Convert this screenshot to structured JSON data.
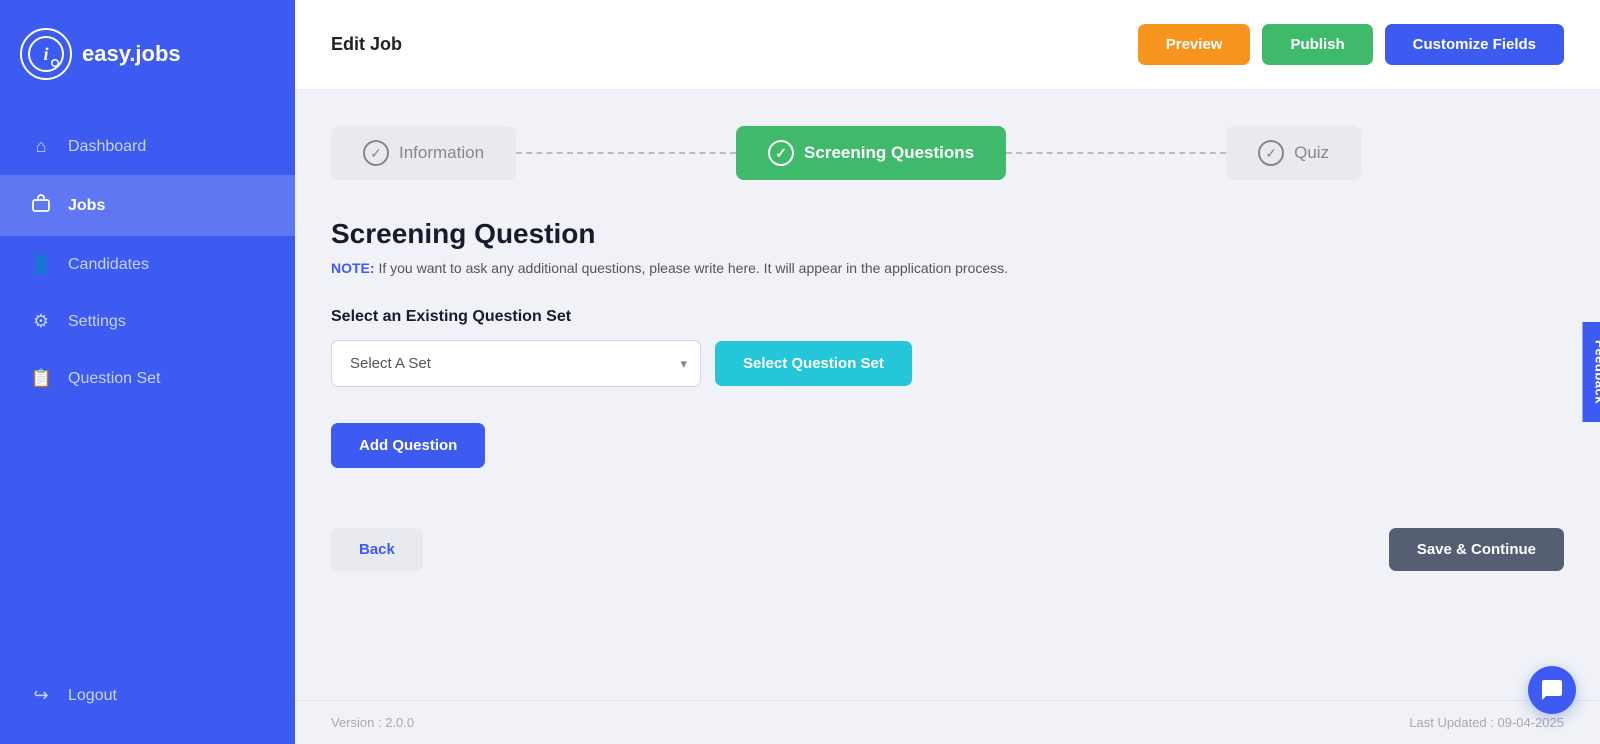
{
  "sidebar": {
    "logo_text": "easy.jobs",
    "items": [
      {
        "id": "dashboard",
        "label": "Dashboard",
        "icon": "⌂",
        "active": false
      },
      {
        "id": "jobs",
        "label": "Jobs",
        "icon": "💼",
        "active": true
      },
      {
        "id": "candidates",
        "label": "Candidates",
        "icon": "👤",
        "active": false
      },
      {
        "id": "settings",
        "label": "Settings",
        "icon": "⚙",
        "active": false
      },
      {
        "id": "question-set",
        "label": "Question Set",
        "icon": "📋",
        "active": false
      }
    ],
    "logout": {
      "label": "Logout",
      "icon": "↪"
    }
  },
  "topbar": {
    "title": "Edit Job",
    "btn_preview": "Preview",
    "btn_publish": "Publish",
    "btn_customize": "Customize Fields"
  },
  "steps": [
    {
      "id": "information",
      "label": "Information",
      "active": false,
      "check": "✓"
    },
    {
      "id": "screening-questions",
      "label": "Screening Questions",
      "active": true,
      "check": "✓"
    },
    {
      "id": "quiz",
      "label": "Quiz",
      "active": false,
      "check": "✓"
    }
  ],
  "main": {
    "section_title": "Screening Question",
    "note_label": "NOTE:",
    "note_text": " If you want to ask any additional questions, please write here. It will appear in the application process.",
    "select_existing_label": "Select an Existing Question Set",
    "select_placeholder": "Select A Set",
    "btn_select_set": "Select Question Set",
    "btn_add_question": "Add Question",
    "btn_back": "Back",
    "btn_save_continue": "Save & Continue"
  },
  "footer": {
    "version": "Version : 2.0.0",
    "last_updated": "Last Updated : 09-04-2025"
  },
  "feedback": "Feedback"
}
